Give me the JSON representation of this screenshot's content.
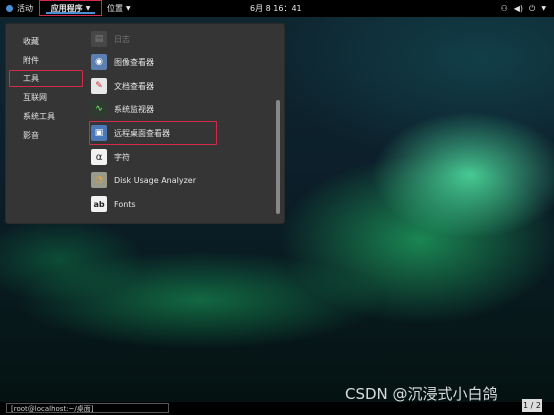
{
  "topbar": {
    "activities": "活动",
    "applications": "应用程序",
    "places": "位置",
    "clock": "6月 8 16：41"
  },
  "categories": [
    "收藏",
    "附件",
    "工具",
    "互联网",
    "系统工具",
    "影音"
  ],
  "apps": [
    {
      "label": "日志",
      "icon": "log-icon",
      "color": "#6a6a6a"
    },
    {
      "label": "图像查看器",
      "icon": "image-viewer-icon",
      "color": "#5b7fb0"
    },
    {
      "label": "文档查看器",
      "icon": "document-viewer-icon",
      "color": "#e8e8e8"
    },
    {
      "label": "系统监视器",
      "icon": "system-monitor-icon",
      "color": "#2e3b2e"
    },
    {
      "label": "远程桌面查看器",
      "icon": "remote-desktop-icon",
      "color": "#4b78b8"
    },
    {
      "label": "字符",
      "icon": "character-map-icon",
      "color": "#f2f2f2"
    },
    {
      "label": "Disk Usage Analyzer",
      "icon": "disk-usage-icon",
      "color": "#9a9a8a"
    },
    {
      "label": "Fonts",
      "icon": "fonts-icon",
      "color": "#f2f2f2"
    }
  ],
  "taskbar": {
    "window": "[root@localhost:~/桌面]"
  },
  "workspace": "1 / 2",
  "watermark": "CSDN @沉浸式小白鸽"
}
